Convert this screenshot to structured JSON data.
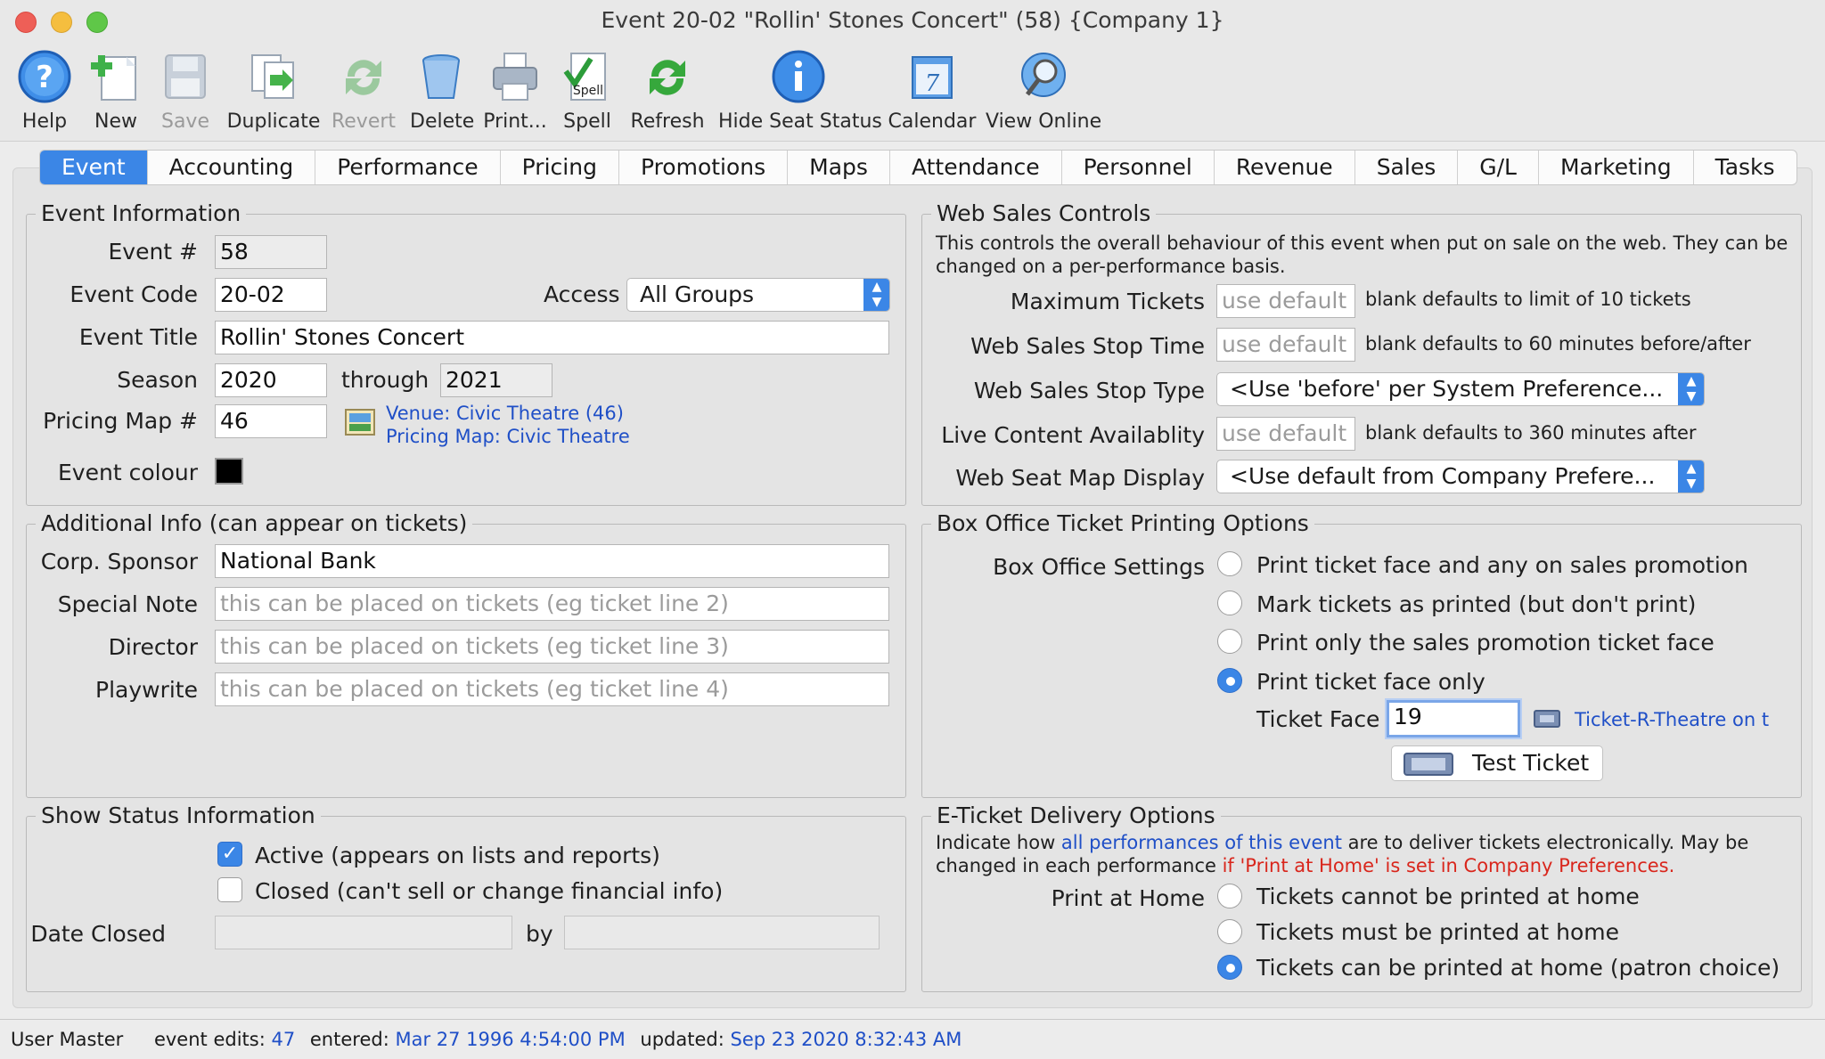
{
  "window": {
    "title": "Event 20-02 \"Rollin' Stones Concert\" (58) {Company 1}"
  },
  "toolbar": [
    {
      "label": "Help",
      "icon": "help-icon",
      "enabled": true
    },
    {
      "label": "New",
      "icon": "new-icon",
      "enabled": true
    },
    {
      "label": "Save",
      "icon": "save-icon",
      "enabled": false
    },
    {
      "label": "Duplicate",
      "icon": "duplicate-icon",
      "enabled": true
    },
    {
      "label": "Revert",
      "icon": "revert-icon",
      "enabled": false
    },
    {
      "label": "Delete",
      "icon": "delete-icon",
      "enabled": true
    },
    {
      "label": "Print...",
      "icon": "print-icon",
      "enabled": true
    },
    {
      "label": "Spell",
      "icon": "spell-icon",
      "enabled": true
    },
    {
      "label": "Refresh",
      "icon": "refresh-icon",
      "enabled": true
    },
    {
      "label": "Hide Seat Status",
      "icon": "info-icon",
      "enabled": true
    },
    {
      "label": "Calendar",
      "icon": "calendar-icon",
      "enabled": true
    },
    {
      "label": "View Online",
      "icon": "view-online-icon",
      "enabled": true
    }
  ],
  "tabs": [
    "Event",
    "Accounting",
    "Performance",
    "Pricing",
    "Promotions",
    "Maps",
    "Attendance",
    "Personnel",
    "Revenue",
    "Sales",
    "G/L",
    "Marketing",
    "Tasks"
  ],
  "event_info": {
    "title": "Event Information",
    "event_num_label": "Event #",
    "event_num": "58",
    "event_code_label": "Event Code",
    "event_code": "20-02",
    "access_label": "Access",
    "access": "All Groups",
    "event_title_label": "Event Title",
    "event_title": "Rollin' Stones Concert",
    "season_label": "Season",
    "season_from": "2020",
    "through_label": "through",
    "season_to": "2021",
    "pricing_map_label": "Pricing Map #",
    "pricing_map": "46",
    "venue_link": "Venue: Civic Theatre (46)",
    "pricing_map_link": "Pricing Map: Civic Theatre",
    "colour_label": "Event colour",
    "colour": "#000000"
  },
  "web_sales": {
    "title": "Web Sales Controls",
    "description": "This controls the overall behaviour of this event when put on sale on the web.  They can be changed on a per-performance basis.",
    "max_tickets_label": "Maximum Tickets",
    "max_tickets_placeholder": "use default",
    "max_tickets_note": "blank defaults to limit of 10 tickets",
    "stop_time_label": "Web Sales Stop Time",
    "stop_time_placeholder": "use default",
    "stop_time_note": "blank defaults to 60 minutes before/after",
    "stop_type_label": "Web Sales Stop Type",
    "stop_type": "<Use 'before' per System Preference...",
    "live_label": "Live Content Availablity",
    "live_placeholder": "use default",
    "live_note": "blank defaults to 360 minutes after",
    "seat_map_label": "Web Seat Map Display",
    "seat_map": "<Use default from Company Prefere..."
  },
  "additional": {
    "title": "Additional Info (can appear on tickets)",
    "sponsor_label": "Corp. Sponsor",
    "sponsor": "National Bank",
    "note_label": "Special Note",
    "note_placeholder": "this can be placed on tickets (eg ticket line 2)",
    "director_label": "Director",
    "director_placeholder": "this can be placed on tickets (eg ticket line 3)",
    "playwrite_label": "Playwrite",
    "playwrite_placeholder": "this can be placed on tickets (eg ticket line 4)"
  },
  "box_office": {
    "title": "Box Office Ticket Printing Options",
    "settings_label": "Box Office Settings",
    "options": [
      "Print ticket face and any on sales promotion",
      "Mark tickets as printed (but don't print)",
      "Print only the sales promotion ticket face",
      "Print ticket face only"
    ],
    "selected": 3,
    "ticket_face_label": "Ticket Face",
    "ticket_face": "19",
    "ticket_face_link": "Ticket-R-Theatre on t",
    "test_ticket": "Test Ticket"
  },
  "show_status": {
    "title": "Show Status Information",
    "active_label": "Active (appears on lists and reports)",
    "active": true,
    "closed_label": "Closed (can't sell or change financial info)",
    "closed": false,
    "date_closed_label": "Date Closed",
    "by_label": "by"
  },
  "eticket": {
    "title": "E-Ticket Delivery Options",
    "desc_1": "Indicate how ",
    "desc_link": "all performances of this event",
    "desc_2": " are to deliver tickets electronically.  May be",
    "desc_3": "changed in each performance ",
    "desc_red": "if 'Print at Home' is set in Company Preferences.",
    "print_home_label": "Print at Home",
    "options": [
      "Tickets cannot be printed at home",
      "Tickets must be printed at home",
      "Tickets can be printed at home (patron choice)"
    ],
    "selected": 2
  },
  "status": {
    "user": "User Master",
    "edits_label": "event edits:",
    "edits": "47",
    "entered_label": "entered:",
    "entered": "Mar 27 1996 4:54:00 PM",
    "updated_label": "updated:",
    "updated": "Sep 23 2020 8:32:43 AM"
  },
  "colors": {
    "accent": "#3b86e6",
    "link": "#1f4fc7",
    "warning": "#d9261c"
  }
}
